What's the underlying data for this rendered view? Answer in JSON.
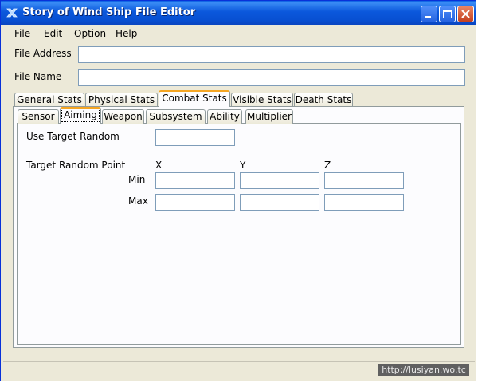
{
  "window": {
    "title": "Story of Wind Ship File Editor",
    "icon": "x-app-icon",
    "controls": [
      "minimize-icon",
      "maximize-icon",
      "close-icon"
    ]
  },
  "menu": [
    "File",
    "Edit",
    "Option",
    "Help"
  ],
  "fields": {
    "file_address_label": "File Address",
    "file_address_value": "",
    "file_name_label": "File Name",
    "file_name_value": ""
  },
  "main_tabs": [
    "General Stats",
    "Physical Stats",
    "Combat Stats",
    "Visible Stats",
    "Death Stats"
  ],
  "main_tab_selected": "Combat Stats",
  "sub_tabs": [
    "Sensor",
    "Aiming",
    "Weapon",
    "Subsystem",
    "Ability",
    "Multiplier"
  ],
  "sub_tab_selected": "Aiming",
  "aiming": {
    "use_target_random_label": "Use Target Random",
    "use_target_random_value": "",
    "target_random_point_label": "Target Random Point",
    "axes": [
      "X",
      "Y",
      "Z"
    ],
    "rows": [
      {
        "label": "Min",
        "values": [
          "",
          "",
          ""
        ]
      },
      {
        "label": "Max",
        "values": [
          "",
          "",
          ""
        ]
      }
    ]
  },
  "watermark": "http://lusiyan.wo.tc"
}
